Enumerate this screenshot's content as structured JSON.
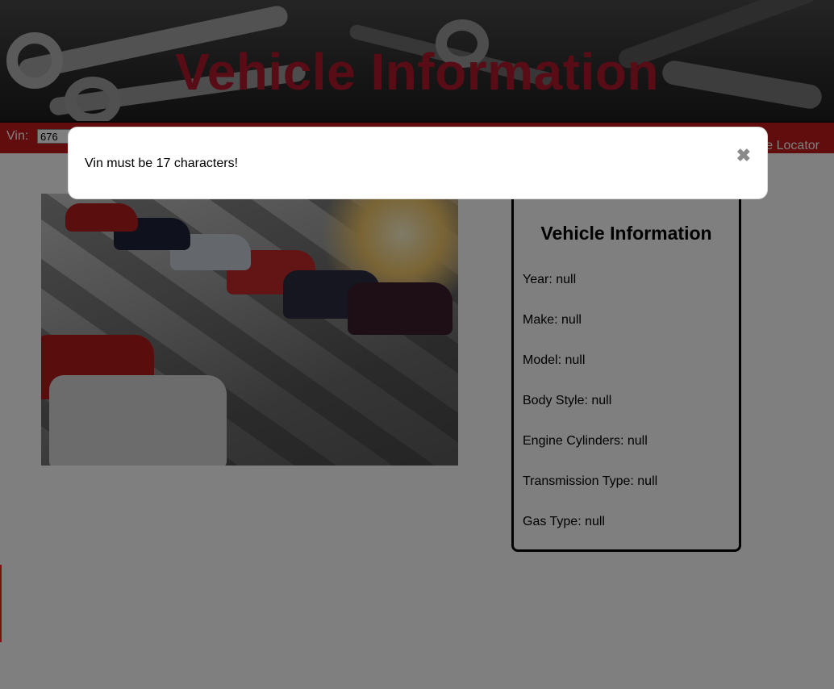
{
  "header": {
    "title": "Vehicle Information"
  },
  "navbar": {
    "vin_label": "Vin:",
    "vin_value": "676",
    "locator_label": "e Locator"
  },
  "image": {
    "alt": "car-parking-lot-photo"
  },
  "info_card": {
    "title": "Vehicle Information",
    "rows": [
      "Year: null",
      "Make: null",
      "Model: null",
      "Body Style: null",
      "Engine Cylinders: null",
      "Transmission Type: null",
      "Gas Type: null"
    ]
  },
  "modal": {
    "message": "Vin must be 17 characters!",
    "close_icon": "close-icon",
    "close_symbol": "✖"
  },
  "colors": {
    "brand_red": "#c41b1b",
    "title_red": "#b0182a",
    "overlay": "rgba(0,0,0,0.5)"
  }
}
